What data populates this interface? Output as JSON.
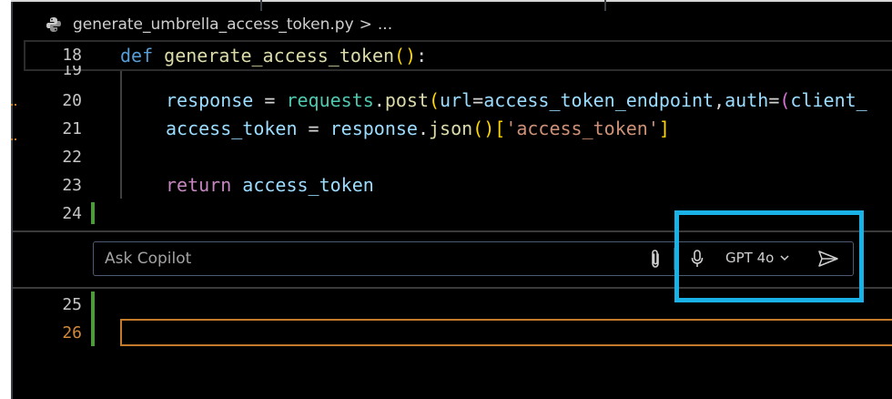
{
  "editor": {
    "breadcrumb": {
      "file_name": "generate_umbrella_access_token.py",
      "separator": ">",
      "more": "..."
    },
    "lines": [
      {
        "number": "18"
      },
      {
        "number": "19"
      },
      {
        "number": "20"
      },
      {
        "number": "21"
      },
      {
        "number": "22"
      },
      {
        "number": "23"
      },
      {
        "number": "24"
      },
      {
        "number": "25"
      },
      {
        "number": "26"
      }
    ],
    "code": {
      "l18": {
        "def": "def",
        "name": "generate_access_token",
        "p1": "(",
        "p2": ")",
        "colon": ":"
      },
      "l20": {
        "lhs": "response",
        "eq": " = ",
        "module": "requests",
        "dot": ".",
        "method": "post",
        "p1": "(",
        "kw_url": "url",
        "eq2": "=",
        "endpoint": "access_token_endpoint",
        "comma": ",",
        "kw_auth": "auth",
        "eq3": "=",
        "p2": "(",
        "client": "client_"
      },
      "l21": {
        "lhs": "access_token",
        "eq": " = ",
        "obj": "response",
        "dot": ".",
        "method": "json",
        "p1": "(",
        "p2": ")",
        "b1": "[",
        "key": "'access_token'",
        "b2": "]"
      },
      "l23": {
        "kw": "return",
        "value": " access_token"
      }
    }
  },
  "copilot": {
    "input_placeholder": "Ask Copilot",
    "model_label": "GPT 4o",
    "icons": {
      "attach": "paperclip-icon",
      "mic": "microphone-icon",
      "model_dropdown": "chevron-down-icon",
      "send": "send-icon"
    }
  },
  "colors": {
    "callout": "#19b1e6",
    "git_added": "#4d9a3a",
    "current_line_border": "#c57a2a"
  }
}
